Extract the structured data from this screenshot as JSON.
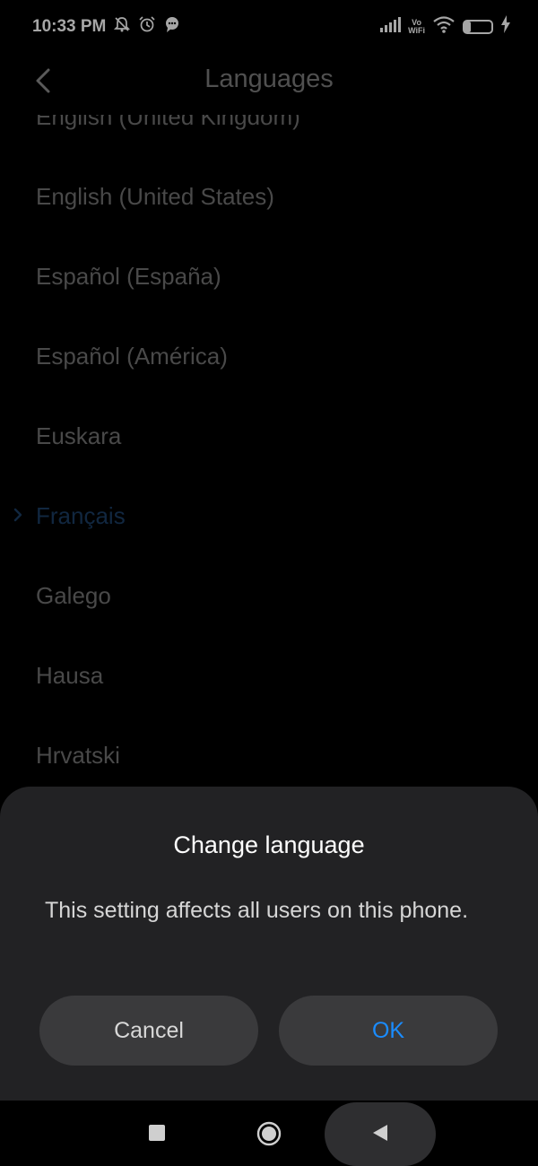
{
  "status_bar": {
    "time": "10:33 PM",
    "left_icons": [
      "bell-off-icon",
      "alarm-icon",
      "chat-bubble-icon"
    ],
    "network": "VoWiFi",
    "network_line1": "Vo",
    "network_line2": "WiFi",
    "battery_level": "24",
    "battery_fraction": 0.24,
    "charging": true
  },
  "header": {
    "title": "Languages",
    "back_icon": "chevron-left-icon"
  },
  "languages": {
    "selected": "Français",
    "items": [
      {
        "label": "English (United Kingdom)"
      },
      {
        "label": "English (United States)"
      },
      {
        "label": "Español (España)"
      },
      {
        "label": "Español (América)"
      },
      {
        "label": "Euskara"
      },
      {
        "label": "Français"
      },
      {
        "label": "Galego"
      },
      {
        "label": "Hausa"
      },
      {
        "label": "Hrvatski"
      }
    ]
  },
  "dialog": {
    "title": "Change language",
    "message": "This setting affects all users on this phone.",
    "cancel_label": "Cancel",
    "ok_label": "OK"
  },
  "nav_bar": {
    "buttons": [
      "square-recent-apps-icon",
      "circle-home-icon",
      "triangle-back-icon"
    ]
  },
  "colors": {
    "background": "#000000",
    "dialog_background": "#222224",
    "button_background": "#3a3a3c",
    "ok_accent": "#1a8cff",
    "selected_item": "#1b3c63"
  }
}
